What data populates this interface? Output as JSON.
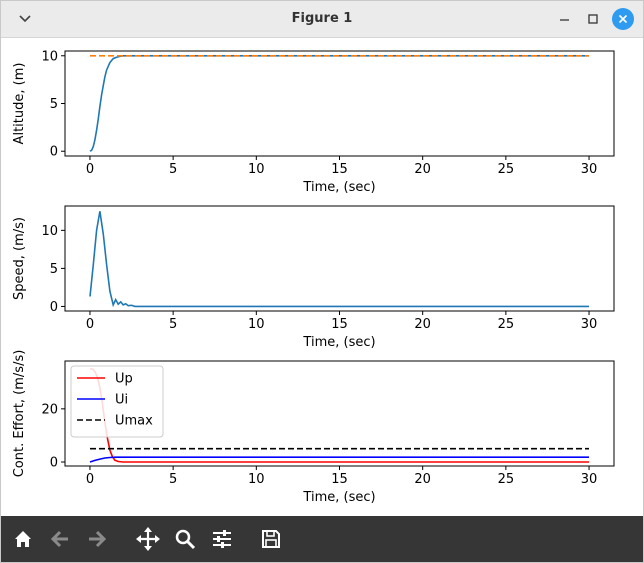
{
  "window": {
    "title": "Figure 1",
    "icons": {
      "menu": "chevron-down-icon",
      "minimize": "minimize-icon",
      "maximize": "maximize-icon",
      "close": "close-icon"
    },
    "close_color": "#2e9bf0"
  },
  "toolbar": {
    "buttons": [
      "home-icon",
      "back-arrow-icon",
      "forward-arrow-icon",
      "pan-icon",
      "zoom-icon",
      "configure-subplots-icon",
      "save-icon"
    ],
    "background": "#363636"
  },
  "chart_data": [
    {
      "type": "line",
      "xlabel": "Time, (sec)",
      "ylabel": "Altitude, (m)",
      "xlim": [
        -1.5,
        31.5
      ],
      "ylim": [
        -0.5,
        10.5
      ],
      "xticks": [
        "0",
        "5",
        "10",
        "15",
        "20",
        "25",
        "30"
      ],
      "yticks": [
        "0",
        "5",
        "10"
      ],
      "series": [
        {
          "color": "#1f77b4",
          "style": "solid",
          "x": [
            0,
            0.1,
            0.2,
            0.3,
            0.4,
            0.5,
            0.6,
            0.7,
            0.8,
            0.9,
            1.0,
            1.2,
            1.4,
            1.6,
            1.8,
            2.0,
            2.5,
            3,
            30
          ],
          "y": [
            0,
            0.1,
            0.5,
            1.2,
            2.2,
            3.4,
            4.7,
            5.9,
            6.9,
            7.8,
            8.5,
            9.3,
            9.7,
            9.85,
            9.95,
            10,
            10,
            10,
            10
          ]
        },
        {
          "color": "#ff7f0e",
          "style": "dashed",
          "x": [
            0,
            30
          ],
          "y": [
            10,
            10
          ]
        }
      ]
    },
    {
      "type": "line",
      "xlabel": "Time, (sec)",
      "ylabel": "Speed, (m/s)",
      "xlim": [
        -1.5,
        31.5
      ],
      "ylim": [
        -0.6,
        13.2
      ],
      "xticks": [
        "0",
        "5",
        "10",
        "15",
        "20",
        "25",
        "30"
      ],
      "yticks": [
        "0",
        "5",
        "10"
      ],
      "series": [
        {
          "color": "#1f77b4",
          "style": "solid",
          "x": [
            0,
            0.2,
            0.4,
            0.6,
            0.8,
            1.0,
            1.2,
            1.4,
            1.55,
            1.7,
            1.85,
            2.0,
            2.15,
            2.3,
            2.5,
            2.7,
            3.0,
            30
          ],
          "y": [
            1.3,
            5.5,
            10,
            12.5,
            9.5,
            5.5,
            2,
            0.2,
            0.9,
            0.3,
            0.6,
            0.2,
            0.35,
            0.1,
            0.15,
            0,
            0,
            0
          ]
        }
      ]
    },
    {
      "type": "line",
      "xlabel": "Time, (sec)",
      "ylabel": "Cont. Effort, (m/s/s)",
      "xlim": [
        -1.5,
        31.5
      ],
      "ylim": [
        -1.5,
        38
      ],
      "xticks": [
        "0",
        "5",
        "10",
        "15",
        "20",
        "25",
        "30"
      ],
      "yticks": [
        "0",
        "20"
      ],
      "legend_position": "top-left",
      "series": [
        {
          "name": "Up",
          "color": "#ff0000",
          "style": "solid",
          "x": [
            0,
            0.15,
            0.3,
            0.45,
            0.6,
            0.75,
            0.9,
            1.05,
            1.2,
            1.35,
            1.5,
            1.7,
            2.0,
            30
          ],
          "y": [
            35,
            35,
            34,
            32,
            28,
            22,
            15,
            9,
            4.5,
            2,
            0.7,
            0.2,
            0,
            0
          ]
        },
        {
          "name": "Ui",
          "color": "#0000ff",
          "style": "solid",
          "x": [
            0,
            0.3,
            0.6,
            0.9,
            1.2,
            1.5,
            2.0,
            30
          ],
          "y": [
            0,
            0.6,
            1.1,
            1.5,
            1.7,
            1.8,
            1.8,
            1.8
          ]
        },
        {
          "name": "Umax",
          "color": "#000000",
          "style": "dashed",
          "x": [
            0,
            30
          ],
          "y": [
            5,
            5
          ]
        }
      ]
    }
  ]
}
